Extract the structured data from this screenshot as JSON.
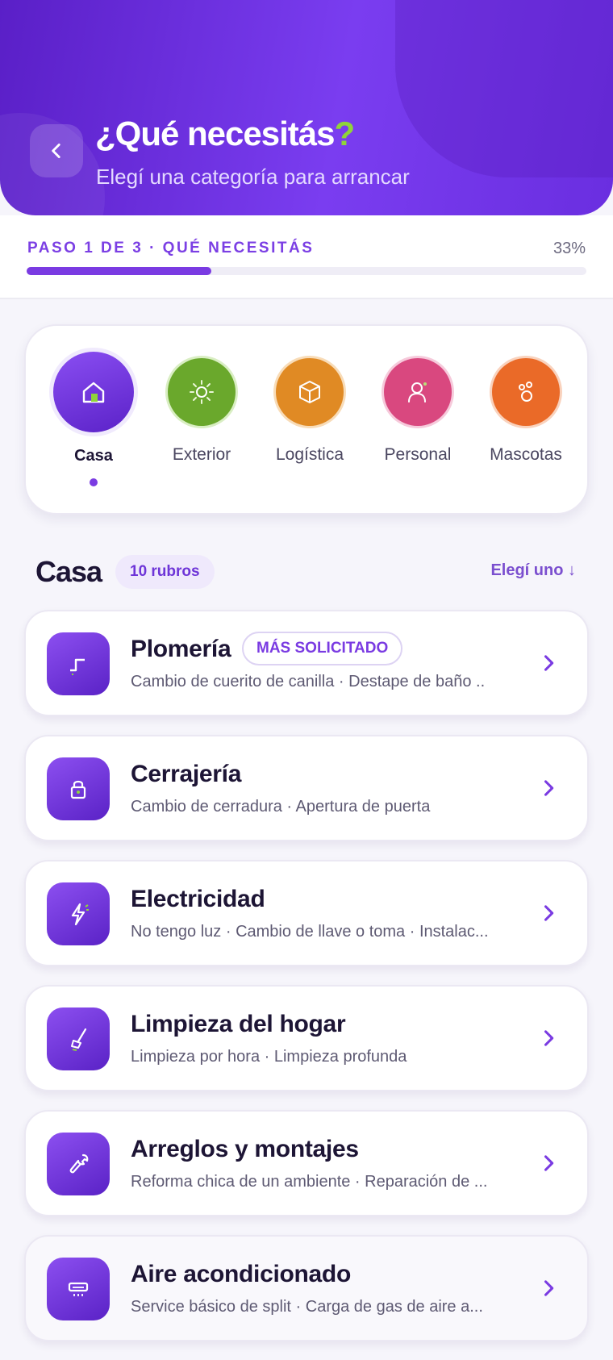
{
  "header": {
    "title_main": "¿Qué necesitás",
    "title_mark": "?",
    "subtitle": "Elegí una categoría para arrancar"
  },
  "progress": {
    "step_label": "PASO 1 DE 3 · QUÉ NECESITÁS",
    "percent_label": "33%",
    "value": 0.33
  },
  "categories": [
    {
      "label": "Casa",
      "icon": "house-icon",
      "color": "#6a2ee0",
      "active": true
    },
    {
      "label": "Exterior",
      "icon": "sun-icon",
      "color": "#6aa82c"
    },
    {
      "label": "Logística",
      "icon": "box-icon",
      "color": "#e08a24"
    },
    {
      "label": "Personal",
      "icon": "person-icon",
      "color": "#d9487f"
    },
    {
      "label": "Mascotas",
      "icon": "paw-icon",
      "color": "#ea6a28"
    }
  ],
  "section": {
    "title": "Casa",
    "badge": "10 rubros",
    "action": "Elegí uno ↓"
  },
  "services": [
    {
      "name": "Plomería",
      "tag": "MÁS SOLICITADO",
      "desc": "Cambio de cuerito de canilla · Destape de baño ..",
      "icon": "pipe-icon"
    },
    {
      "name": "Cerrajería",
      "desc": "Cambio de cerradura · Apertura de puerta",
      "icon": "lock-icon"
    },
    {
      "name": "Electricidad",
      "desc": "No tengo luz · Cambio de llave o toma · Instalac...",
      "icon": "lightning-icon"
    },
    {
      "name": "Limpieza del hogar",
      "desc": "Limpieza por hora · Limpieza profunda",
      "icon": "broom-icon"
    },
    {
      "name": "Arreglos y montajes",
      "desc": "Reforma chica de un ambiente · Reparación de ...",
      "icon": "wrench-icon"
    },
    {
      "name": "Aire acondicionado",
      "desc": "Service básico de split · Carga de gas de aire a...",
      "icon": "air-conditioner-icon"
    }
  ],
  "colors": {
    "accent": "#7a3be2",
    "brand_green": "#8fd43a"
  }
}
